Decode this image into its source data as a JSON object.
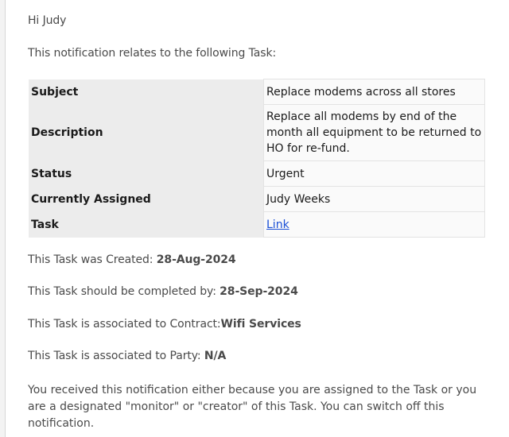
{
  "email": {
    "greeting": "Hi Judy",
    "intro": "This notification relates to the following Task:",
    "task_table": {
      "rows": [
        {
          "label": "Subject",
          "value": "Replace modems across all stores"
        },
        {
          "label": "Description",
          "value": "Replace all modems by end of the month all equipment to be returned to HO for re-fund."
        },
        {
          "label": "Status",
          "value": "Urgent"
        },
        {
          "label": "Currently Assigned",
          "value": "Judy Weeks"
        },
        {
          "label": "Task",
          "value": "Link"
        }
      ]
    },
    "created_label": "This Task was Created: ",
    "created_value": "28-Aug-2024",
    "due_label": "This Task should be completed by: ",
    "due_value": "28-Sep-2024",
    "contract_label": "This Task is associated to Contract:",
    "contract_value": "Wifi Services",
    "party_label": "This Task is associated to Party: ",
    "party_value": "N/A",
    "notice": "You received this notification either because you are assigned to the Task or you are a designated \"monitor\" or \"creator\" of this Task. You can switch off this notification."
  }
}
